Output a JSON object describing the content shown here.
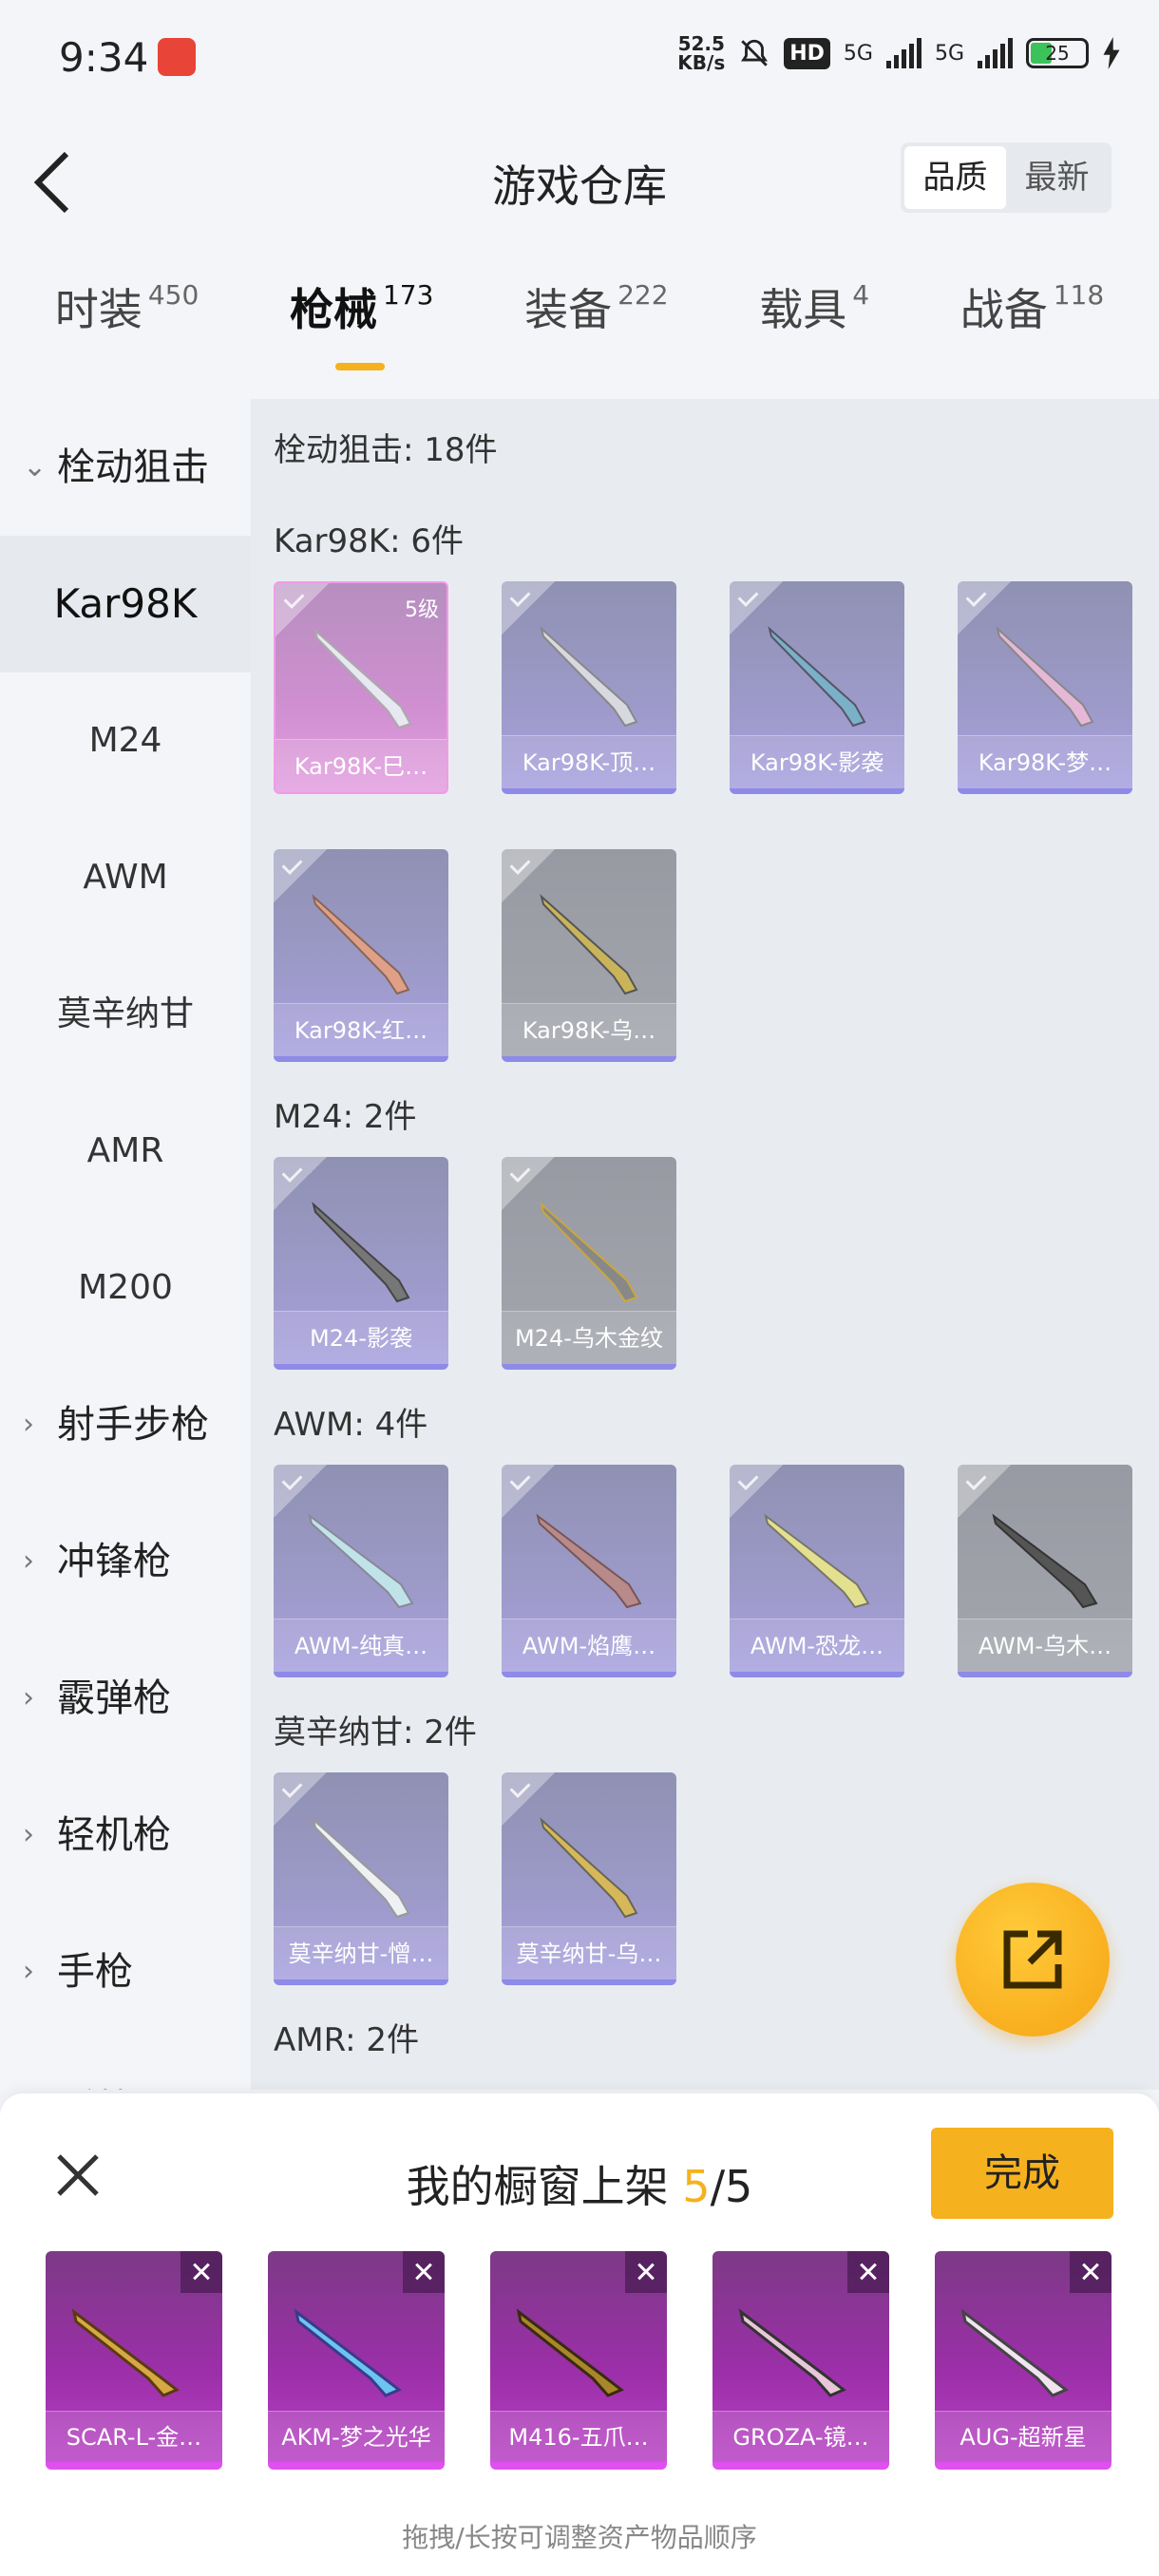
{
  "status_bar": {
    "time": "9:34",
    "speed_value": "52.5",
    "speed_unit": "KB/s",
    "hd": "HD",
    "net1": "5G",
    "net2": "5G",
    "battery": "25"
  },
  "header": {
    "title": "游戏仓库",
    "sort_quality": "品质",
    "sort_latest": "最新"
  },
  "tabs": [
    {
      "label": "时装",
      "count": "450"
    },
    {
      "label": "枪械",
      "count": "173"
    },
    {
      "label": "装备",
      "count": "222"
    },
    {
      "label": "载具",
      "count": "4"
    },
    {
      "label": "战备",
      "count": "118"
    }
  ],
  "sidebar": {
    "group_open": "栓动狙击",
    "items": [
      "Kar98K",
      "M24",
      "AWM",
      "莫辛纳甘",
      "AMR",
      "M200"
    ],
    "groups": [
      "射手步枪",
      "冲锋枪",
      "霰弹枪",
      "轻机枪",
      "手枪",
      "近战"
    ]
  },
  "main": {
    "category_header": "栓动狙击: 18件",
    "sections": [
      {
        "header": "Kar98K: 6件",
        "items": [
          {
            "name": "Kar98K-巳…",
            "level": "5级"
          },
          {
            "name": "Kar98K-顶…"
          },
          {
            "name": "Kar98K-影袭"
          },
          {
            "name": "Kar98K-梦…"
          },
          {
            "name": "Kar98K-红…"
          },
          {
            "name": "Kar98K-乌…"
          }
        ]
      },
      {
        "header": "M24: 2件",
        "items": [
          {
            "name": "M24-影袭"
          },
          {
            "name": "M24-乌木金纹"
          }
        ]
      },
      {
        "header": "AWM: 4件",
        "items": [
          {
            "name": "AWM-纯真…"
          },
          {
            "name": "AWM-焰鹰…"
          },
          {
            "name": "AWM-恐龙…"
          },
          {
            "name": "AWM-乌木…"
          }
        ]
      },
      {
        "header": "莫辛纳甘: 2件",
        "items": [
          {
            "name": "莫辛纳甘-憎…"
          },
          {
            "name": "莫辛纳甘-乌…"
          }
        ]
      },
      {
        "header": "AMR: 2件",
        "items": []
      }
    ]
  },
  "panel": {
    "title": "我的橱窗上架",
    "count": "5",
    "total": "/5",
    "done": "完成",
    "slots": [
      "SCAR-L-金…",
      "AKM-梦之光华",
      "M416-五爪…",
      "GROZA-镜…",
      "AUG-超新星"
    ],
    "hint": "拖拽/长按可调整资产物品顺序"
  },
  "colors": {
    "accent": "#f6b11e",
    "card_purple": "#9d9ac9",
    "card_pink": "#d08fd1",
    "slot_purple": "#9b2fa8"
  },
  "icons": [
    "back-icon",
    "chevron-down-icon",
    "chevron-right-icon",
    "check-icon",
    "share-icon",
    "close-icon"
  ]
}
